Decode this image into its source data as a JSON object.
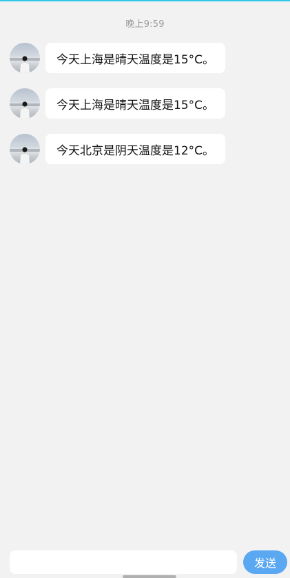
{
  "header": {
    "timestamp": "晚上9:59"
  },
  "messages": [
    {
      "text": "今天上海是晴天温度是15°C。"
    },
    {
      "text": "今天上海是晴天温度是15°C。"
    },
    {
      "text": "今天北京是阴天温度是12°C。"
    }
  ],
  "composer": {
    "input_value": "",
    "send_label": "发送"
  },
  "colors": {
    "background": "#f2f2f2",
    "bubble": "#ffffff",
    "send_button": "#5aa8f2",
    "top_accent": "#2fc6e8"
  },
  "icons": {
    "avatar": "avatar-photo-icon"
  }
}
